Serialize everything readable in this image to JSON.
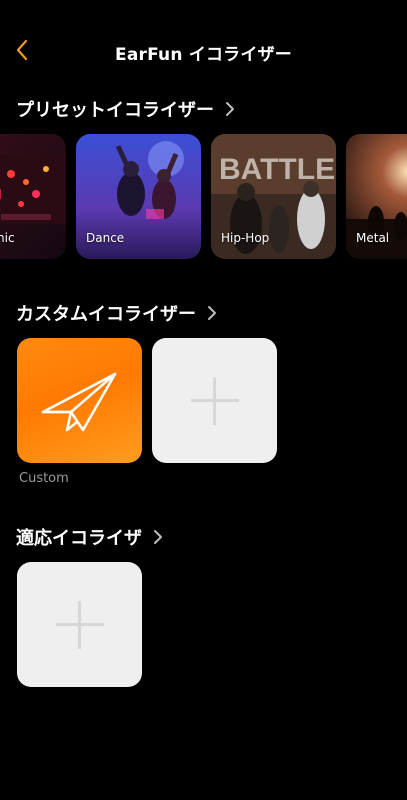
{
  "header": {
    "title": "EarFun イコライザー"
  },
  "sections": {
    "preset": {
      "title": "プリセットイコライザー"
    },
    "custom": {
      "title": "カスタムイコライザー"
    },
    "adaptive": {
      "title": "適応イコライザ"
    }
  },
  "presets": [
    {
      "label": "nic"
    },
    {
      "label": "Dance"
    },
    {
      "label": "Hip-Hop"
    },
    {
      "label": "Metal"
    }
  ],
  "custom_items": [
    {
      "label": "Custom",
      "icon": "paper-plane-icon"
    }
  ],
  "colors": {
    "accent": "#ff8a00",
    "background": "#000000",
    "add_tile": "#efefef"
  }
}
